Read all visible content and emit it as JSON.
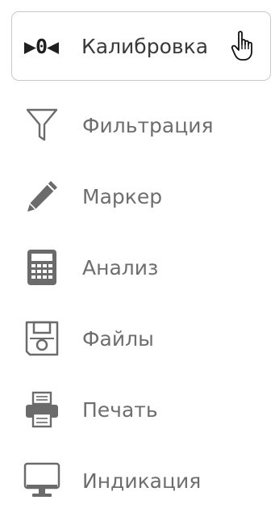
{
  "menu": {
    "items": [
      {
        "label": "Калибровка",
        "icon": "calibration-icon",
        "glyph": "▶0◀",
        "active": true
      },
      {
        "label": "Фильтрация",
        "icon": "filter-icon"
      },
      {
        "label": "Маркер",
        "icon": "pencil-icon"
      },
      {
        "label": "Анализ",
        "icon": "calculator-icon"
      },
      {
        "label": "Файлы",
        "icon": "floppy-disk-icon"
      },
      {
        "label": "Печать",
        "icon": "printer-icon"
      },
      {
        "label": "Индикация",
        "icon": "monitor-icon"
      }
    ]
  },
  "colors": {
    "icon": "#6b6b6b",
    "label": "#6e6e6e",
    "active_label": "#3a3a3a",
    "active_border": "#c9c9c9"
  }
}
